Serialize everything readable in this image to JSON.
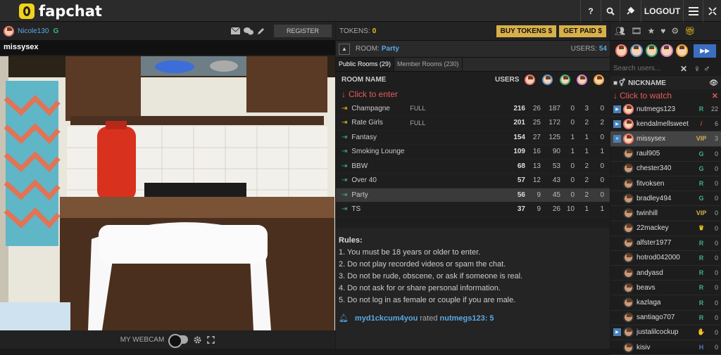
{
  "brand": {
    "name": "fapchat"
  },
  "topnav": {
    "help": "?",
    "search": "🔍",
    "plug": "✎",
    "logout": "LOGOUT",
    "menu": "☰",
    "expand": "⤢"
  },
  "user": {
    "name": "Nicole130",
    "badge": "G"
  },
  "register_label": "REGISTER",
  "cam": {
    "title": "missysex",
    "webcam_label": "MY WEBCAM"
  },
  "tokens": {
    "label": "TOKENS:",
    "value": "0",
    "buy": "BUY TOKENS $",
    "earn": "GET PAID $"
  },
  "room": {
    "label": "ROOM:",
    "name": "Party",
    "users_label": "USERS:",
    "users": "54"
  },
  "tabs": [
    "Public Rooms (29)",
    "Member Rooms (230)"
  ],
  "table": {
    "col_name": "ROOM NAME",
    "col_users": "USERS",
    "click_to_enter": "Click to enter",
    "rows": [
      {
        "name": "Champagne",
        "status": "FULL",
        "u": "216",
        "a": "26",
        "b": "187",
        "c": "0",
        "d": "3",
        "e": "0",
        "type": "full"
      },
      {
        "name": "Rate Girls",
        "status": "FULL",
        "u": "201",
        "a": "25",
        "b": "172",
        "c": "0",
        "d": "2",
        "e": "2",
        "type": "full"
      },
      {
        "name": "Fantasy",
        "status": "",
        "u": "154",
        "a": "27",
        "b": "125",
        "c": "1",
        "d": "1",
        "e": "0",
        "type": "open"
      },
      {
        "name": "Smoking Lounge",
        "status": "",
        "u": "109",
        "a": "16",
        "b": "90",
        "c": "1",
        "d": "1",
        "e": "1",
        "type": "open"
      },
      {
        "name": "BBW",
        "status": "",
        "u": "68",
        "a": "13",
        "b": "53",
        "c": "0",
        "d": "2",
        "e": "0",
        "type": "open"
      },
      {
        "name": "Over 40",
        "status": "",
        "u": "57",
        "a": "12",
        "b": "43",
        "c": "0",
        "d": "2",
        "e": "0",
        "type": "open"
      },
      {
        "name": "Party",
        "status": "",
        "u": "56",
        "a": "9",
        "b": "45",
        "c": "0",
        "d": "2",
        "e": "0",
        "type": "open"
      },
      {
        "name": "TS",
        "status": "",
        "u": "37",
        "a": "9",
        "b": "26",
        "c": "10",
        "d": "1",
        "e": "1",
        "type": "open"
      }
    ]
  },
  "rules": {
    "title": "Rules:",
    "items": [
      "1. You must be 18 years or older to enter.",
      "2. Do not play recorded videos or spam the chat.",
      "3. Do not be rude, obscene, or ask if someone is real.",
      "4. Do not ask for or share personal information.",
      "5. Do not log in as female or couple if you are male."
    ]
  },
  "notice": {
    "user": "myd1ckcum4you",
    "action": "rated",
    "target": "nutmegs123",
    "score": ": 5"
  },
  "sidebar": {
    "search_placeholder": "Search users...",
    "nickname_label": "NICKNAME",
    "click_to_watch": "Click to watch",
    "users": [
      {
        "name": "nutmegs123",
        "badge": "R",
        "count": "22",
        "cam": true,
        "g": "f",
        "bc": "#3fb27f"
      },
      {
        "name": "kendalmellsweet",
        "badge": "/",
        "count": "6",
        "cam": true,
        "g": "f",
        "bc": "#e33"
      },
      {
        "name": "missysex",
        "badge": "VIP",
        "count": "3",
        "cam": true,
        "g": "f",
        "bc": "#d8b04a",
        "sel": true
      },
      {
        "name": "raul905",
        "badge": "G",
        "count": "0",
        "cam": false,
        "g": "m",
        "bc": "#3fb27f"
      },
      {
        "name": "chester340",
        "badge": "G",
        "count": "0",
        "cam": false,
        "g": "m",
        "bc": "#3fb27f"
      },
      {
        "name": "fitvoksen",
        "badge": "R",
        "count": "0",
        "cam": false,
        "g": "m",
        "bc": "#3fb27f"
      },
      {
        "name": "bradley494",
        "badge": "G",
        "count": "0",
        "cam": false,
        "g": "m",
        "bc": "#3fb27f"
      },
      {
        "name": "twinhill",
        "badge": "VIP",
        "count": "0",
        "cam": false,
        "g": "m",
        "bc": "#d8b04a"
      },
      {
        "name": "22mackey",
        "badge": "♛",
        "count": "0",
        "cam": false,
        "g": "m",
        "bc": "#e8c21a"
      },
      {
        "name": "alfster1977",
        "badge": "R",
        "count": "0",
        "cam": false,
        "g": "m",
        "bc": "#3fb27f"
      },
      {
        "name": "hotrod042000",
        "badge": "R",
        "count": "0",
        "cam": false,
        "g": "m",
        "bc": "#3fb27f"
      },
      {
        "name": "andyasd",
        "badge": "R",
        "count": "0",
        "cam": false,
        "g": "m",
        "bc": "#3fb27f"
      },
      {
        "name": "beavs",
        "badge": "R",
        "count": "0",
        "cam": false,
        "g": "m",
        "bc": "#3fb27f"
      },
      {
        "name": "kazlaga",
        "badge": "R",
        "count": "0",
        "cam": false,
        "g": "m",
        "bc": "#3fb27f"
      },
      {
        "name": "santiago707",
        "badge": "R",
        "count": "0",
        "cam": false,
        "g": "m",
        "bc": "#3fb27f"
      },
      {
        "name": "justalilcockup",
        "badge": "✋",
        "count": "0",
        "cam": true,
        "g": "m",
        "bc": "#f2a08a"
      },
      {
        "name": "kisiv",
        "badge": "H",
        "count": "0",
        "cam": false,
        "g": "m",
        "bc": "#4a7fb8"
      }
    ]
  }
}
